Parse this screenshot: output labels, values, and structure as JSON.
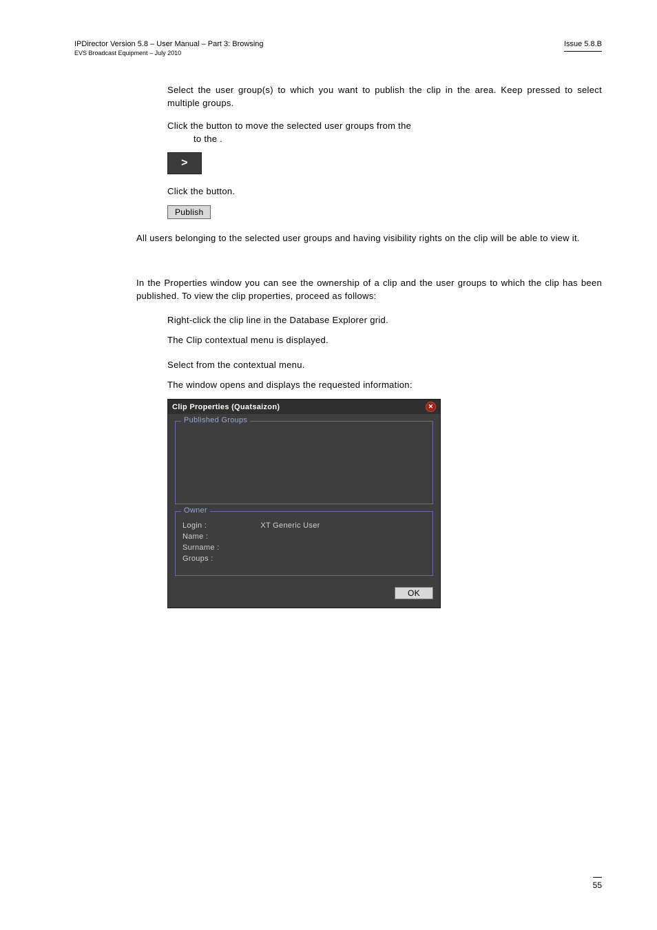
{
  "header": {
    "left_top": "IPDirector Version 5.8 – User Manual – Part 3: Browsing",
    "left_bottom": "EVS Broadcast Equipment – July 2010",
    "right": "Issue 5.8.B"
  },
  "steps_a": {
    "s2": "Select the user group(s) to which you want to publish the clip in the area. Keep pressed to select multiple groups.",
    "s3_line1": "Click the button to move the selected user groups from the",
    "s3_line2": "to the .",
    "arrow_symbol": ">",
    "s4": "Click the button.",
    "publish_label": "Publish"
  },
  "para_a": "All users belonging to the selected user groups and having visibility rights on the clip will be able to view it.",
  "section_b_title": "",
  "para_b": "In the Properties window you can see the ownership of a clip and the user groups to which the clip has been published. To view the clip properties, proceed as follows:",
  "steps_b": {
    "s1a": "Right-click the clip line in the Database Explorer grid.",
    "s1b": "The Clip contextual menu is displayed.",
    "s2a": "Select from the contextual menu.",
    "s2b": "The window opens and displays the requested information:"
  },
  "dialog": {
    "title": "Clip Properties (Quatsaizon)",
    "published_legend": "Published Groups",
    "owner_legend": "Owner",
    "login_label": "Login :",
    "login_value": "XT Generic User",
    "name_label": "Name :",
    "surname_label": "Surname :",
    "groups_label": "Groups :",
    "ok": "OK"
  },
  "page_number": "55"
}
